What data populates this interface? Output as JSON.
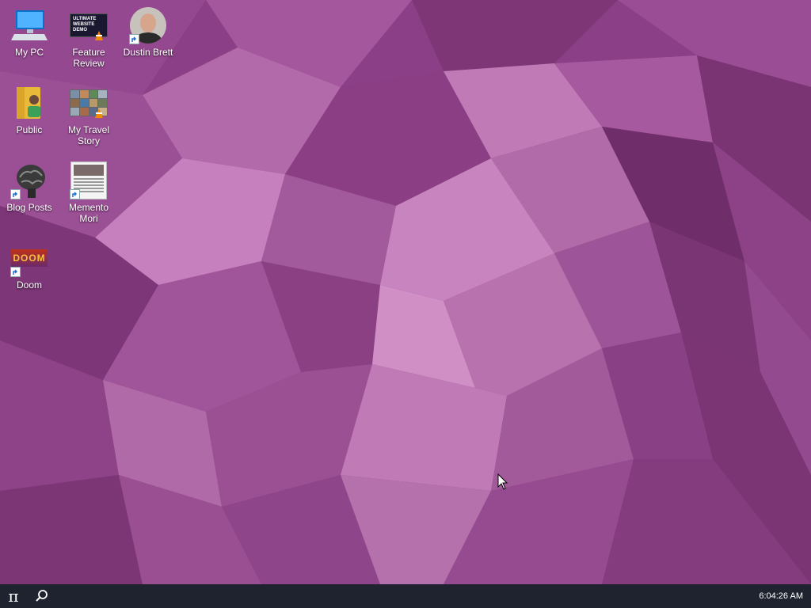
{
  "desktop": {
    "icons": [
      {
        "label": "My PC"
      },
      {
        "label": "Feature Review",
        "thumb_text": "ULTIMATE WEBSITE DEMO"
      },
      {
        "label": "Dustin Brett"
      },
      {
        "label": "Public"
      },
      {
        "label": "My Travel Story"
      },
      {
        "label": "Blog Posts"
      },
      {
        "label": "Memento Mori"
      },
      {
        "label": "Doom",
        "thumb_text": "DOOM"
      }
    ]
  },
  "taskbar": {
    "start_glyph": "π",
    "clock": "6:04:26 AM"
  },
  "colors": {
    "wallpaper_base": "#8a3f86",
    "taskbar": "#1f2330"
  }
}
